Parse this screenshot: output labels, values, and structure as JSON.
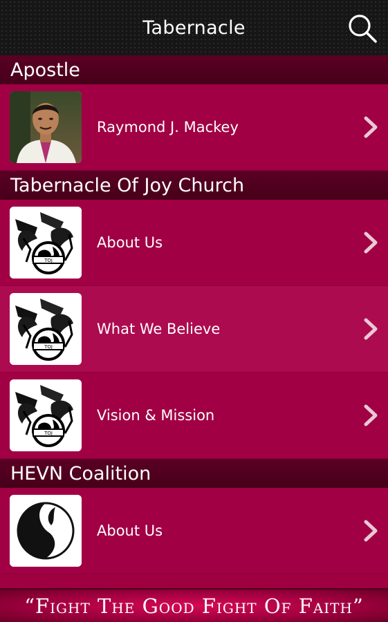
{
  "app": {
    "title": "Tabernacle",
    "search_icon": "search-icon"
  },
  "sections": [
    {
      "header": "Apostle",
      "items": [
        {
          "label": "Raymond J. Mackey",
          "thumb": "portrait-photo",
          "chevron": "chevron-right-icon"
        }
      ]
    },
    {
      "header": "Tabernacle Of Joy Church",
      "items": [
        {
          "label": "About Us",
          "thumb": "angels-globe-logo",
          "chevron": "chevron-right-icon"
        },
        {
          "label": "What We Believe",
          "thumb": "angels-globe-logo",
          "chevron": "chevron-right-icon"
        },
        {
          "label": "Vision & Mission",
          "thumb": "angels-globe-logo",
          "chevron": "chevron-right-icon"
        }
      ]
    },
    {
      "header": "HEVN Coalition",
      "items": [
        {
          "label": "About Us",
          "thumb": "yin-yang-dove-logo",
          "chevron": "chevron-right-icon"
        }
      ]
    }
  ],
  "footer": {
    "quote": "“Fight The Good Fight Of Faith”"
  },
  "colors": {
    "topbar": "#161616",
    "section_header": "#4f001d",
    "row": "#a10044",
    "row_highlight": "#ad0b50",
    "accent": "#d60a55"
  }
}
